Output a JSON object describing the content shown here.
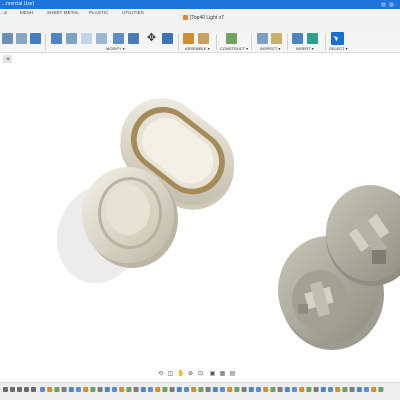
{
  "window": {
    "title": "...mercial Use)"
  },
  "tabs": [
    {
      "label": "...S"
    },
    {
      "label": "MESH"
    },
    {
      "label": "SHEET METAL"
    },
    {
      "label": "PLASTIC"
    },
    {
      "label": "UTILITIES"
    }
  ],
  "document_tab": {
    "label": "[Top40 Light v7"
  },
  "toolbar": {
    "groups": [
      {
        "label": "MODIFY ▾"
      },
      {
        "label": "ASSEMBLE ▾"
      },
      {
        "label": "CONSTRUCT ▾"
      },
      {
        "label": "INSPECT ▾"
      },
      {
        "label": "INSERT ▾"
      },
      {
        "label": "SELECT ▾"
      }
    ],
    "accent_color": "#1b6fd0"
  },
  "colors": {
    "titlebar": "#1e74d8",
    "model_light": "#d6d1c0",
    "model_face": "#ebe7da",
    "model_dark": "#b9b4a3",
    "inner_ring": "#a58b58",
    "cross_part": "#aaa99a"
  },
  "icons": [
    "create-sketch-icon",
    "extrude-icon",
    "revolve-icon",
    "fillet-icon",
    "shell-icon",
    "move-icon",
    "joint-icon",
    "plane-icon",
    "measure-icon",
    "insert-decal-icon",
    "select-cursor-icon",
    "orbit-icon",
    "pan-icon",
    "zoom-icon"
  ]
}
